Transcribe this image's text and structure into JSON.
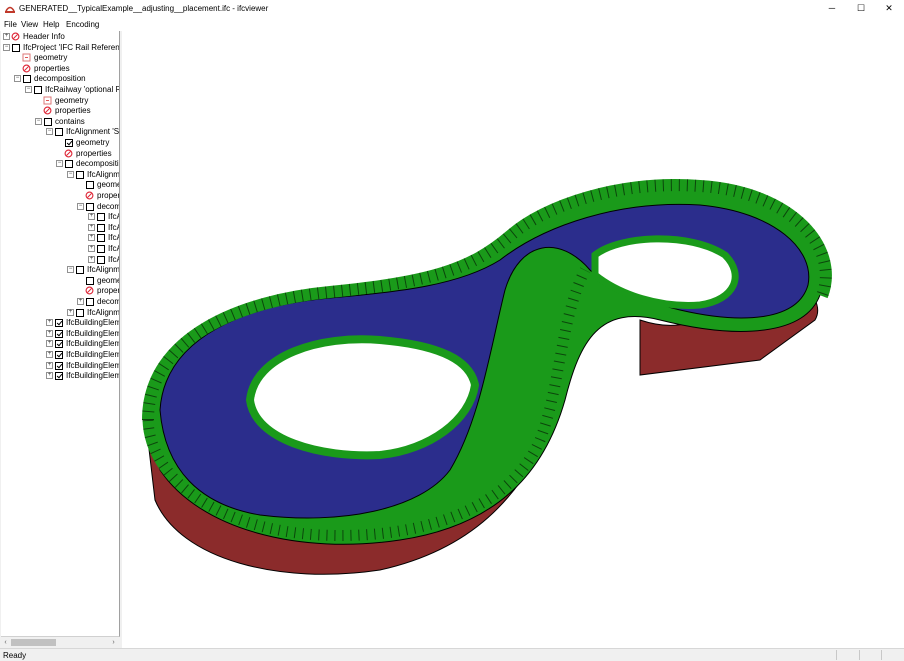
{
  "window": {
    "title": "GENERATED__TypicalExample__adjusting__placement.ifc - ifcviewer",
    "minimize_glyph": "─",
    "maximize_glyph": "☐",
    "close_glyph": "✕"
  },
  "menu": [
    "File",
    "View",
    "Help",
    "Encoding"
  ],
  "tree": [
    {
      "label": "Header Info",
      "expander": "+",
      "icon": "properties-icon"
    },
    {
      "label": "IfcProject 'IFC Rail Referenced'",
      "expander": "−",
      "icon": "checkbox",
      "checked": false
    },
    {
      "label": "geometry",
      "icon": "geometry-icon"
    },
    {
      "label": "properties",
      "icon": "properties-icon"
    },
    {
      "label": "decomposition",
      "expander": "−",
      "icon": "checkbox",
      "checked": false
    },
    {
      "label": "IfcRailway 'optional Rail'",
      "expander": "−",
      "icon": "checkbox",
      "checked": false
    },
    {
      "label": "geometry",
      "icon": "geometry-icon"
    },
    {
      "label": "properties",
      "icon": "properties-icon"
    },
    {
      "label": "contains",
      "expander": "−",
      "icon": "checkbox",
      "checked": false
    },
    {
      "label": "IfcAlignment 'Sp",
      "expander": "−",
      "icon": "checkbox",
      "checked": false
    },
    {
      "label": "geometry",
      "icon": "checkbox",
      "checked": true
    },
    {
      "label": "properties",
      "icon": "properties-icon"
    },
    {
      "label": "decompositic",
      "expander": "−",
      "icon": "checkbox",
      "checked": false
    },
    {
      "label": "IfcAlignme",
      "expander": "−",
      "icon": "checkbox",
      "checked": false
    },
    {
      "label": "geome",
      "icon": "checkbox",
      "checked": false
    },
    {
      "label": "proper",
      "icon": "properties-icon"
    },
    {
      "label": "decom",
      "expander": "−",
      "icon": "checkbox",
      "checked": false
    },
    {
      "label": "IfcA",
      "expander": "+",
      "icon": "checkbox",
      "checked": false
    },
    {
      "label": "IfcA",
      "expander": "+",
      "icon": "checkbox",
      "checked": false
    },
    {
      "label": "IfcA",
      "expander": "+",
      "icon": "checkbox",
      "checked": false
    },
    {
      "label": "IfcA",
      "expander": "+",
      "icon": "checkbox",
      "checked": false
    },
    {
      "label": "IfcA",
      "expander": "+",
      "icon": "checkbox",
      "checked": false
    },
    {
      "label": "IfcAlignme",
      "expander": "−",
      "icon": "checkbox",
      "checked": false
    },
    {
      "label": "geome",
      "icon": "checkbox",
      "checked": false
    },
    {
      "label": "proper",
      "icon": "properties-icon"
    },
    {
      "label": "decom",
      "expander": "+",
      "icon": "checkbox",
      "checked": false
    },
    {
      "label": "IfcAlignme",
      "expander": "+",
      "icon": "checkbox",
      "checked": false
    },
    {
      "label": "IfcBuildingEleme",
      "expander": "+",
      "icon": "checkbox",
      "checked": true
    },
    {
      "label": "IfcBuildingEleme",
      "expander": "+",
      "icon": "checkbox",
      "checked": true
    },
    {
      "label": "IfcBuildingEleme",
      "expander": "+",
      "icon": "checkbox",
      "checked": true
    },
    {
      "label": "IfcBuildingEleme",
      "expander": "+",
      "icon": "checkbox",
      "checked": true
    },
    {
      "label": "IfcBuildingEleme",
      "expander": "+",
      "icon": "checkbox",
      "checked": true
    },
    {
      "label": "IfcBuildingEleme",
      "expander": "+",
      "icon": "checkbox",
      "checked": true
    }
  ],
  "scroll": {
    "left_arrow": "‹",
    "right_arrow": "›"
  },
  "status": {
    "text": "Ready"
  },
  "colors": {
    "track_blue": "#2b2d8c",
    "wall_green": "#1a9a1a",
    "base_red": "#8b2b2b",
    "edge": "#000000"
  }
}
